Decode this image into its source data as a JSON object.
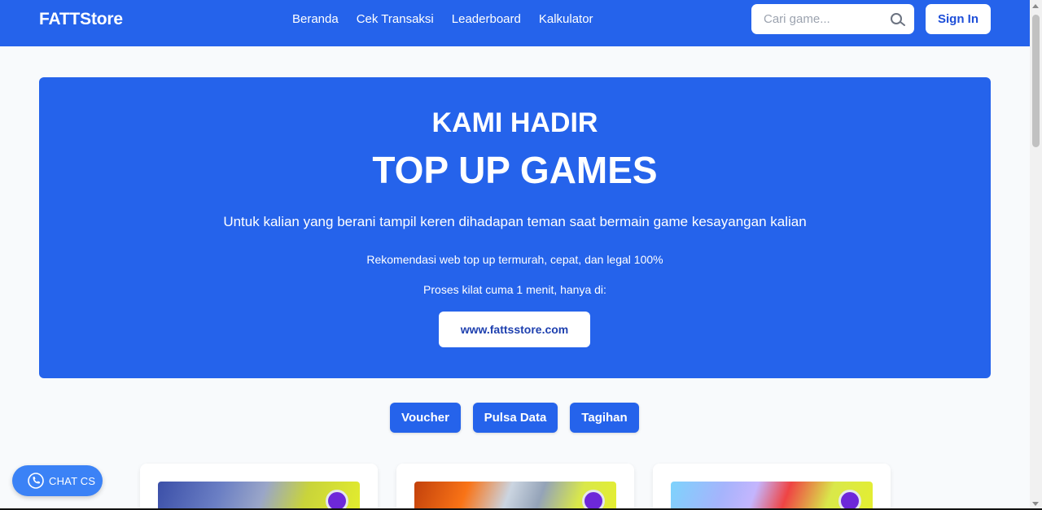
{
  "nav": {
    "brand": "FATTStore",
    "links": [
      "Beranda",
      "Cek Transaksi",
      "Leaderboard",
      "Kalkulator"
    ],
    "search_placeholder": "Cari game...",
    "signin_label": "Sign In"
  },
  "hero": {
    "heading": "KAMI HADIR",
    "title": "TOP UP GAMES",
    "subtitle": "Untuk kalian yang berani tampil keren dihadapan teman saat bermain game kesayangan kalian",
    "recommendation": "Rekomendasi web top up termurah, cepat, dan legal 100%",
    "process": "Proses kilat cuma 1 menit, hanya di:",
    "url_button": "www.fattsstore.com"
  },
  "categories": [
    "Voucher",
    "Pulsa Data",
    "Tagihan"
  ],
  "chat": {
    "label": "CHAT CS"
  },
  "colors": {
    "primary": "#2563eb",
    "background": "#f8fafc"
  }
}
